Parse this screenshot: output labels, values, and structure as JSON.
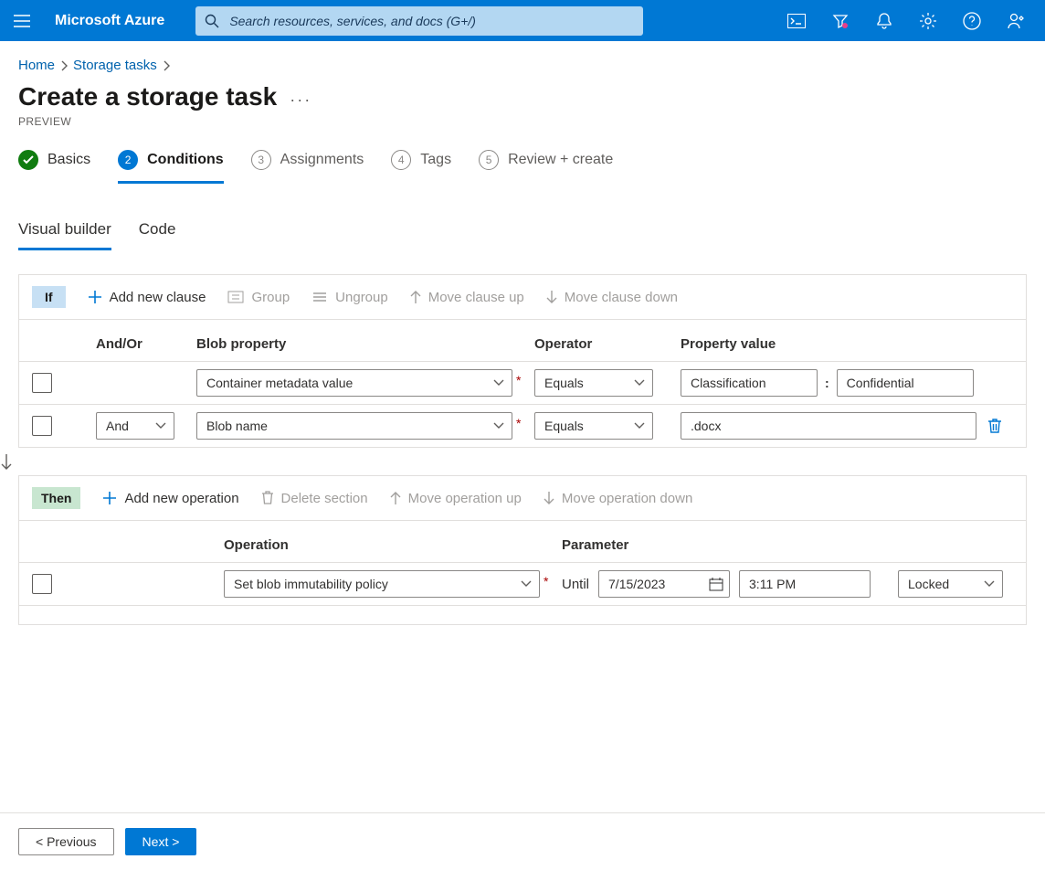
{
  "brand": "Microsoft Azure",
  "search": {
    "placeholder": "Search resources, services, and docs (G+/)"
  },
  "breadcrumb": {
    "items": [
      "Home",
      "Storage tasks"
    ]
  },
  "page": {
    "title": "Create a storage task",
    "subtitle": "PREVIEW"
  },
  "steps": [
    {
      "label": "Basics",
      "state": "done",
      "num": "1"
    },
    {
      "label": "Conditions",
      "state": "active",
      "num": "2"
    },
    {
      "label": "Assignments",
      "state": "idle",
      "num": "3"
    },
    {
      "label": "Tags",
      "state": "idle",
      "num": "4"
    },
    {
      "label": "Review + create",
      "state": "idle",
      "num": "5"
    }
  ],
  "subtabs": [
    {
      "label": "Visual builder",
      "active": true
    },
    {
      "label": "Code",
      "active": false
    }
  ],
  "if": {
    "tag": "If",
    "toolbar": {
      "add": "Add new clause",
      "group": "Group",
      "ungroup": "Ungroup",
      "move_up": "Move clause up",
      "move_down": "Move clause down"
    },
    "headers": {
      "and_or": "And/Or",
      "property": "Blob property",
      "operator": "Operator",
      "value": "Property value"
    },
    "rows": [
      {
        "and_or": "",
        "property": "Container metadata value",
        "operator": "Equals",
        "value_a": "Classification",
        "value_b": "Confidential",
        "paired": true
      },
      {
        "and_or": "And",
        "property": "Blob name",
        "operator": "Equals",
        "value_a": ".docx",
        "paired": false
      }
    ]
  },
  "then": {
    "tag": "Then",
    "toolbar": {
      "add": "Add new operation",
      "delete": "Delete section",
      "move_up": "Move operation up",
      "move_down": "Move operation down"
    },
    "headers": {
      "operation": "Operation",
      "parameter": "Parameter"
    },
    "rows": [
      {
        "operation": "Set blob immutability policy",
        "until_label": "Until",
        "date": "7/15/2023",
        "time": "3:11 PM",
        "lock": "Locked"
      }
    ]
  },
  "footer": {
    "prev": "< Previous",
    "next": "Next >"
  }
}
